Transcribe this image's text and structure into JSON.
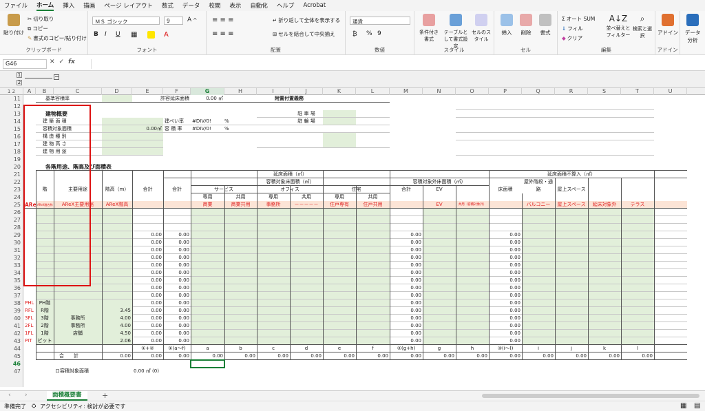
{
  "menu": [
    "ファイル",
    "ホーム",
    "挿入",
    "描画",
    "ページ レイアウト",
    "数式",
    "データ",
    "校閲",
    "表示",
    "自動化",
    "ヘルプ",
    "Acrobat"
  ],
  "menu_active": "ホーム",
  "ribbon": {
    "clipboard": {
      "label": "クリップボード",
      "paste": "貼り付け",
      "cut": "切り取り",
      "copy": "コピー",
      "format_painter": "書式のコピー/貼り付け"
    },
    "font": {
      "label": "フォント",
      "name": "ＭＳ ゴシック",
      "size": "9",
      "bold": "B",
      "italic": "I",
      "underline": "U"
    },
    "alignment": {
      "label": "配置",
      "wrap": "折り返して全体を表示する",
      "merge": "セルを結合して中央揃え"
    },
    "number": {
      "label": "数値",
      "format": "通貨",
      "percent": "%",
      "comma": "9"
    },
    "styles": {
      "label": "スタイル",
      "conditional": "条件付き書式",
      "table": "テーブルとして書式設定",
      "cell": "セルのスタイル"
    },
    "cells": {
      "label": "セル",
      "insert": "挿入",
      "delete": "削除",
      "format": "書式"
    },
    "editing": {
      "label": "編集",
      "autosum": "オート SUM",
      "fill": "フィル",
      "clear": "クリア",
      "sort": "並べ替えとフィルター",
      "find": "検索と選択"
    },
    "addin": {
      "label": "アドイン",
      "addins": "アドイン"
    },
    "analysis": {
      "label": "データ分析"
    }
  },
  "namebox": "G46",
  "fx": "fx",
  "outline_levels": [
    "1",
    "2"
  ],
  "columns": [
    {
      "id": "A",
      "w": 18
    },
    {
      "id": "B",
      "w": 26
    },
    {
      "id": "C",
      "w": 70
    },
    {
      "id": "D",
      "w": 44
    },
    {
      "id": "E",
      "w": 45
    },
    {
      "id": "F",
      "w": 40
    },
    {
      "id": "G",
      "w": 49
    },
    {
      "id": "H",
      "w": 47
    },
    {
      "id": "I",
      "w": 48
    },
    {
      "id": "J",
      "w": 48
    },
    {
      "id": "K",
      "w": 48
    },
    {
      "id": "L",
      "w": 49
    },
    {
      "id": "M",
      "w": 48
    },
    {
      "id": "N",
      "w": 48
    },
    {
      "id": "O",
      "w": 48
    },
    {
      "id": "P",
      "w": 48
    },
    {
      "id": "Q",
      "w": 48
    },
    {
      "id": "R",
      "w": 48
    },
    {
      "id": "S",
      "w": 48
    },
    {
      "id": "T",
      "w": 48
    },
    {
      "id": "U",
      "w": 48
    }
  ],
  "active_col": "G",
  "rows": [
    "11",
    "12",
    "13",
    "14",
    "15",
    "16",
    "17",
    "18",
    "19",
    "20",
    "21",
    "22",
    "23",
    "24",
    "25",
    "26",
    "27",
    "28",
    "29",
    "30",
    "31",
    "32",
    "33",
    "34",
    "35",
    "36",
    "37",
    "38",
    "39",
    "40",
    "41",
    "42",
    "43",
    "44",
    "45",
    "46",
    "47"
  ],
  "active_row": "46",
  "top_section": {
    "r11_label": "基準容積率",
    "r11_allowed": "許容延床面積",
    "r11_allowed_val": "0.00 ㎡",
    "r11_parking": "附置付置義務",
    "title": "建物概要",
    "building_area": "建 築 面 積",
    "floor_area": "容積対象面積",
    "floor_area_val": "0.00㎡",
    "structure": "構 造 種 別",
    "height": "建 物 高 さ",
    "use": "建 物 用 途",
    "coverage": "建ぺい率",
    "coverage_val": "#DIV/0!",
    "coverage_unit": "%",
    "far": "容 積 率",
    "far_val": "#DIV/0!",
    "far_unit": "%",
    "car": "駐 車 場",
    "bike": "駐 輪 場"
  },
  "table": {
    "title": "各階用途、階高及び面積表",
    "floor": "階",
    "use": "主要用途",
    "height": "階高（m）",
    "total": "合計",
    "gross": "延床面積（㎡）",
    "far_area": "容積対象床面積（㎡）",
    "subtotal": "合計",
    "service": "サービス",
    "office": "オフィス",
    "housing": "住宅",
    "exclusive": "専用",
    "shared": "共用",
    "non_far": "容積対象外床面積（㎡）",
    "ev": "EV",
    "excluded": "延床面積不算入（㎡）",
    "floor_area": "床面積",
    "outdoor_stair": "屋外階段・通路",
    "roof_space": "屋上スペース"
  },
  "areX_row": {
    "label": "AReX階",
    "b": "AReX階名称",
    "c": "AReX主要用途",
    "d": "AReX階高",
    "g": "商業",
    "h": "商業共用",
    "i": "事務所",
    "j": "－－－－－",
    "k": "住戸専有",
    "l": "住戸共用",
    "n": "EV",
    "o": "共用（容積対象外）",
    "q": "バルコニー",
    "r": "屋上スペース",
    "s": "延床対象外",
    "t": "テラス"
  },
  "floors": [
    {
      "a": "PHL",
      "b": "PH階",
      "c": "",
      "d": ""
    },
    {
      "a": "RFL",
      "b": "R階",
      "c": "",
      "d": "3.45"
    },
    {
      "a": "3FL",
      "b": "3階",
      "c": "事務所",
      "d": "4.00"
    },
    {
      "a": "2FL",
      "b": "2階",
      "c": "事務所",
      "d": "4.00"
    },
    {
      "a": "1FL",
      "b": "1階",
      "c": "店舗",
      "d": "4.50"
    },
    {
      "a": "PIT",
      "b": "ピット",
      "c": "",
      "d": "2.06"
    }
  ],
  "zero": "0.00",
  "row44": {
    "e": "①+②",
    "f": "①(a〜f)",
    "g": "a",
    "h": "b",
    "i": "c",
    "j": "d",
    "k": "e",
    "l": "f",
    "m": "②(g+h)",
    "n": "g",
    "o": "h",
    "p": "③(i〜l)",
    "q": "i",
    "r": "j",
    "s": "k",
    "t": "l"
  },
  "row45": {
    "label": "合　　計"
  },
  "row47": {
    "label": "ロ容積対象面積",
    "val": "0.00 ㎡ (0)"
  },
  "sheet_tab": "面積概要書",
  "add_sheet": "+",
  "status": {
    "ready": "準備完了",
    "accessibility": "アクセシビリティ: 検討が必要です"
  },
  "colors": {
    "green": "#e2efda",
    "pink": "#fce4d6",
    "red": "#e02020",
    "accent": "#1a7f37"
  }
}
